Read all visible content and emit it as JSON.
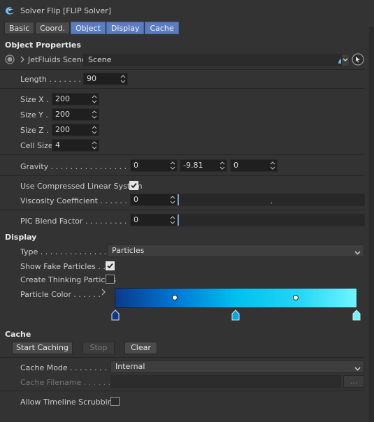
{
  "window": {
    "title": "Solver Flip [FLIP Solver]"
  },
  "tabs": [
    "Basic",
    "Coord.",
    "Object",
    "Display",
    "Cache"
  ],
  "object_properties": {
    "heading": "Object Properties",
    "scene_label": "JetFluids Scene",
    "scene_value": "Scene",
    "length_label": "Length . . . . . . . .",
    "length_value": "90",
    "size_x_label": "Size X .",
    "size_x_value": "200",
    "size_y_label": "Size Y .",
    "size_y_value": "200",
    "size_z_label": "Size Z .",
    "size_z_value": "200",
    "cell_size_label": "Cell Size",
    "cell_size_value": "4",
    "gravity_label": "Gravity . . . . . . . . . . . . . . . . .",
    "gravity_x": "0",
    "gravity_y": "-9.81",
    "gravity_z": "0",
    "compressed_label": "Use Compressed Linear System",
    "compressed_checked": true,
    "viscosity_label": "Viscosity Coefficient . . . . . . .",
    "viscosity_value": "0",
    "pic_label": "PIC Blend Factor . . . . . . . . . .",
    "pic_value": "0"
  },
  "display": {
    "heading": "Display",
    "type_label": "Type . . . . . . . . . . . . . . .",
    "type_value": "Particles",
    "fake_label": "Show Fake Particles . . .",
    "fake_checked": true,
    "thinking_label": "Create Thinking Particles",
    "thinking_checked": false,
    "color_label": "Particle Color . . . . . .",
    "gradient_colors": [
      "#0a3a8c",
      "#00b3f0",
      "#6ff5ff"
    ]
  },
  "cache": {
    "heading": "Cache",
    "start_label": "Start Caching",
    "stop_label": "Stop",
    "clear_label": "Clear",
    "mode_label": "Cache Mode . . . . . . . .",
    "mode_value": "Internal",
    "filename_label": "Cache Filename . . . . . .",
    "browse_label": "...",
    "scrub_label": "Allow Timeline Scrubbing",
    "scrub_checked": false
  },
  "colors": {
    "accent": "#5c7cc2",
    "background": "#333333",
    "field": "#1f1f1f"
  }
}
